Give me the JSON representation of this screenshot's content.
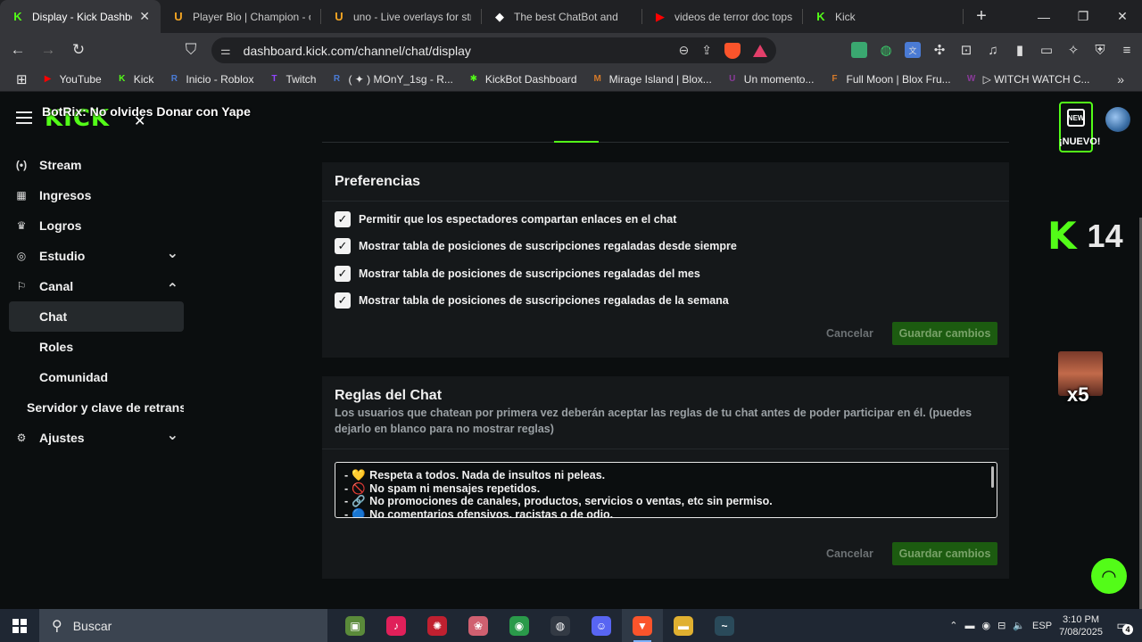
{
  "browser": {
    "tabs": [
      {
        "title": "Display - Kick Dashboard",
        "favicon": "kick-icon",
        "active": true,
        "color": "#53fc18",
        "glyph": "K"
      },
      {
        "title": "Player Bio | Champion - ov",
        "favicon": "u-icon",
        "active": false,
        "color": "#f5a623",
        "glyph": "U"
      },
      {
        "title": "uno - Live overlays for stre",
        "favicon": "u-icon",
        "active": false,
        "color": "#f5a623",
        "glyph": "U"
      },
      {
        "title": "The best ChatBot and",
        "favicon": "chatbot-icon",
        "active": false,
        "color": "#ffffff",
        "glyph": "◆"
      },
      {
        "title": "videos de terror doc tops",
        "favicon": "youtube-icon",
        "active": false,
        "color": "#ff0000",
        "glyph": "▶"
      },
      {
        "title": "Kick",
        "favicon": "kick-icon",
        "active": false,
        "color": "#53fc18",
        "glyph": "K"
      }
    ],
    "url": "dashboard.kick.com/channel/chat/display",
    "shield_badge": "2",
    "bookmarks": [
      {
        "label": "YouTube",
        "color": "#ff0000",
        "glyph": "▶"
      },
      {
        "label": "Kick",
        "color": "#53fc18",
        "glyph": "K"
      },
      {
        "label": "Inicio - Roblox",
        "color": "#4a7bd5",
        "glyph": "R"
      },
      {
        "label": "Twitch",
        "color": "#9146ff",
        "glyph": "T"
      },
      {
        "label": "( ✦ ) MOnY_1sg - R...",
        "color": "#4a7bd5",
        "glyph": "R"
      },
      {
        "label": "KickBot Dashboard",
        "color": "#53fc18",
        "glyph": "✱"
      },
      {
        "label": "Mirage Island | Blox...",
        "color": "#d47a2a",
        "glyph": "M"
      },
      {
        "label": "Un momento...",
        "color": "#8a3a9a",
        "glyph": "U"
      },
      {
        "label": "Full Moon | Blox Fru...",
        "color": "#d47a2a",
        "glyph": "F"
      },
      {
        "label": "▷ WITCH WATCH C...",
        "color": "#8a3a9a",
        "glyph": "W"
      }
    ]
  },
  "header": {
    "logo": "KICK",
    "overlay_text": "BotRix: No olvides Donar con Yape",
    "nuevo_label": "¡NUEVO!",
    "nuevo_icon_text": "NEW"
  },
  "sidebar": {
    "items": [
      {
        "label": "Stream",
        "icon": "broadcast-icon",
        "glyph": "(•)"
      },
      {
        "label": "Ingresos",
        "icon": "income-icon",
        "glyph": "▦"
      },
      {
        "label": "Logros",
        "icon": "trophy-icon",
        "glyph": "♛"
      },
      {
        "label": "Estudio",
        "icon": "studio-icon",
        "glyph": "◎",
        "chevron": "down"
      },
      {
        "label": "Canal",
        "icon": "channel-icon",
        "glyph": "⚐",
        "chevron": "up"
      }
    ],
    "subitems": [
      {
        "label": "Chat",
        "active": true
      },
      {
        "label": "Roles",
        "active": false
      },
      {
        "label": "Comunidad",
        "active": false
      },
      {
        "label": "Servidor y clave de retransmisión",
        "active": false
      }
    ],
    "settings": {
      "label": "Ajustes",
      "icon": "gear-icon",
      "glyph": "⚙"
    }
  },
  "preferences": {
    "title": "Preferencias",
    "options": [
      {
        "label": "Permitir que los espectadores compartan enlaces en el chat",
        "checked": true
      },
      {
        "label": "Mostrar tabla de posiciones de suscripciones regaladas desde siempre",
        "checked": true
      },
      {
        "label": "Mostrar tabla de posiciones de suscripciones regaladas del mes",
        "checked": true
      },
      {
        "label": "Mostrar tabla de posiciones de suscripciones regaladas de la semana",
        "checked": true
      }
    ],
    "cancel_label": "Cancelar",
    "save_label": "Guardar cambios"
  },
  "rules": {
    "title": "Reglas del Chat",
    "description": "Los usuarios que chatean por primera vez deberán aceptar las reglas de tu chat antes de poder participar en él. (puedes dejarlo en blanco para no mostrar reglas)",
    "lines": [
      {
        "prefix": "-",
        "emoji": "💛",
        "text": "Respeta a todos. Nada de insultos ni peleas."
      },
      {
        "prefix": "-",
        "emoji": "🚫",
        "text": "No spam ni mensajes repetidos."
      },
      {
        "prefix": "-",
        "emoji": "🔗",
        "text": "No promociones de canales, productos, servicios o ventas, etc sin permiso."
      },
      {
        "prefix": "-",
        "emoji": "🔵",
        "text": "No comentarios ofensivos, racistas o de odio."
      }
    ],
    "cancel_label": "Cancelar",
    "save_label": "Guardar cambios"
  },
  "overlays": {
    "kick_count": "14",
    "face_multiplier": "x5"
  },
  "taskbar": {
    "search_placeholder": "Buscar",
    "apps": [
      {
        "name": "minecraft-icon",
        "color": "#5a8a3a",
        "glyph": "▣"
      },
      {
        "name": "tiktok-icon",
        "color": "#e0205a",
        "glyph": "♪"
      },
      {
        "name": "app-red-icon",
        "color": "#c02030",
        "glyph": "✺"
      },
      {
        "name": "app-brain-icon",
        "color": "#d06070",
        "glyph": "❀"
      },
      {
        "name": "chrome-icon",
        "color": "#2a9a4a",
        "glyph": "◉"
      },
      {
        "name": "obs-icon",
        "color": "#333a44",
        "glyph": "◍"
      },
      {
        "name": "discord-icon",
        "color": "#5865f2",
        "glyph": "☺"
      },
      {
        "name": "brave-icon",
        "color": "#fb542b",
        "glyph": "▼",
        "active": true
      },
      {
        "name": "file-explorer-icon",
        "color": "#e0b030",
        "glyph": "▬"
      },
      {
        "name": "terminal-icon",
        "color": "#2a4a5a",
        "glyph": "~"
      }
    ],
    "language": "ESP",
    "time": "3:10 PM",
    "date": "7/08/2025",
    "notifications": "4"
  }
}
